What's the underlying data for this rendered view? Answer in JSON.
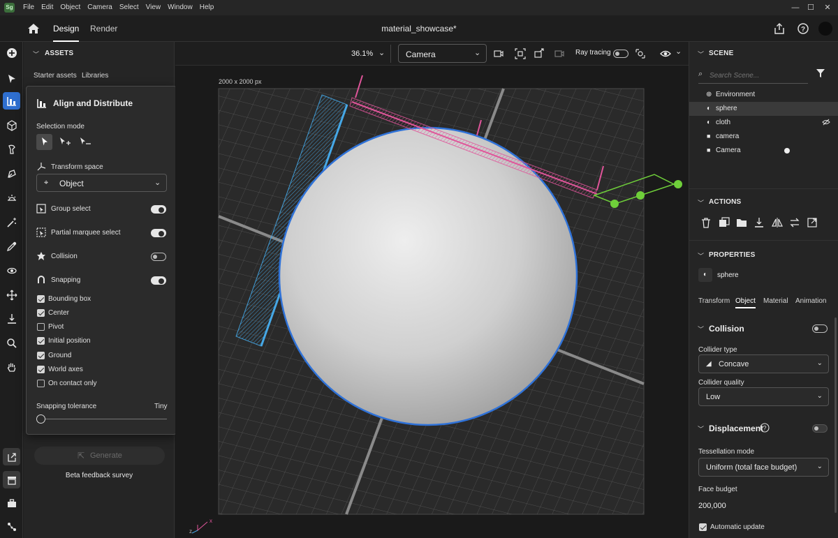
{
  "menubar": {
    "logo": "Sg",
    "items": [
      "File",
      "Edit",
      "Object",
      "Camera",
      "Select",
      "View",
      "Window",
      "Help"
    ]
  },
  "topbar": {
    "tabs": [
      "Design",
      "Render"
    ],
    "document_title": "material_showcase*"
  },
  "assets": {
    "header": "ASSETS",
    "subtabs": [
      "Starter assets",
      "Libraries"
    ],
    "generate_label": "Generate",
    "feedback_link": "Beta feedback survey"
  },
  "align_popover": {
    "title": "Align and Distribute",
    "selection_mode_label": "Selection mode",
    "transform_space_label": "Transform space",
    "transform_space_value": "Object",
    "toggles": [
      {
        "label": "Group select",
        "on": true
      },
      {
        "label": "Partial marquee select",
        "on": true
      },
      {
        "label": "Collision",
        "on": false
      },
      {
        "label": "Snapping",
        "on": true
      }
    ],
    "checkboxes": [
      {
        "label": "Bounding box",
        "checked": true
      },
      {
        "label": "Center",
        "checked": true
      },
      {
        "label": "Pivot",
        "checked": false
      },
      {
        "label": "Initial position",
        "checked": true
      },
      {
        "label": "Ground",
        "checked": true
      },
      {
        "label": "World axes",
        "checked": true
      },
      {
        "label": "On contact only",
        "checked": false
      }
    ],
    "snapping_tolerance_label": "Snapping tolerance",
    "snapping_tolerance_value": "Tiny",
    "snapping_tolerance_level": 0
  },
  "viewport": {
    "zoom": "36.1%",
    "camera": "Camera",
    "ray_tracing_label": "Ray tracing",
    "canvas_size": "2000 x 2000 px",
    "axis_x": "x",
    "axis_z": "z"
  },
  "scene": {
    "header": "SCENE",
    "search_placeholder": "Search Scene...",
    "items": [
      {
        "label": "Environment",
        "icon": "globe-icon",
        "selected": false
      },
      {
        "label": "sphere",
        "icon": "cube-icon",
        "selected": true
      },
      {
        "label": "cloth",
        "icon": "cube-icon",
        "selected": false
      },
      {
        "label": "camera",
        "icon": "camera-icon",
        "selected": false
      },
      {
        "label": "Camera",
        "icon": "camera-icon",
        "selected": false
      }
    ]
  },
  "actions": {
    "header": "ACTIONS"
  },
  "properties": {
    "header": "PROPERTIES",
    "object_name": "sphere",
    "tabs": [
      "Transform",
      "Object",
      "Material",
      "Animation"
    ],
    "collision_header": "Collision",
    "collider_type_label": "Collider type",
    "collider_type_value": "Concave",
    "collider_quality_label": "Collider quality",
    "collider_quality_value": "Low",
    "displacement_header": "Displacement",
    "tessellation_label": "Tessellation mode",
    "tessellation_value": "Uniform (total face budget)",
    "face_budget_label": "Face budget",
    "face_budget_value": "200,000",
    "auto_update_label": "Automatic update"
  },
  "colors": {
    "accent": "#2f6fd0",
    "gizmo_x": "#e0559a",
    "gizmo_y": "#6fcf3a",
    "gizmo_z": "#46a8e6",
    "sphere_outline": "#2f72d8"
  }
}
